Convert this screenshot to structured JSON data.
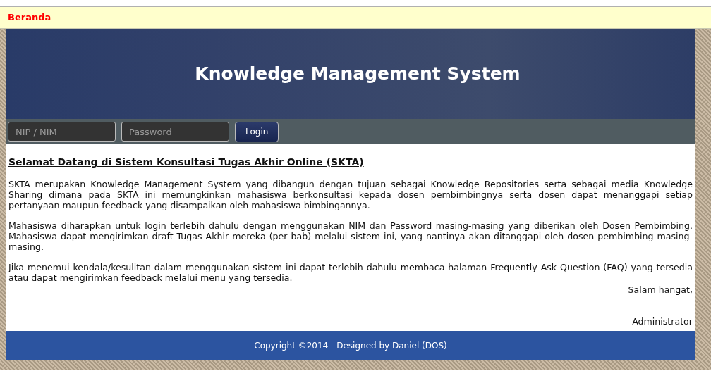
{
  "top_bar": {
    "breadcrumb": "Beranda"
  },
  "header": {
    "title": "Knowledge Management System"
  },
  "login_bar": {
    "username": {
      "placeholder": "NIP / NIM"
    },
    "password": {
      "placeholder": "Password"
    },
    "button": "Login"
  },
  "content": {
    "heading": "Selamat Datang di Sistem Konsultasi Tugas Akhir Online (SKTA)",
    "paragraphs": [
      "SKTA merupakan Knowledge Management System yang dibangun dengan tujuan sebagai Knowledge Repositories serta sebagai media Knowledge Sharing dimana pada SKTA ini memungkinkan mahasiswa berkonsultasi kepada dosen pembimbingnya serta dosen dapat menanggapi setiap pertanyaan maupun feedback yang disampaikan oleh mahasiswa bimbingannya.",
      "Mahasiswa diharapkan untuk login terlebih dahulu dengan menggunakan NIM dan Password masing-masing yang diberikan oleh Dosen Pembimbing. Mahasiswa dapat mengirimkan draft Tugas Akhir mereka (per bab) melalui sistem ini, yang nantinya akan ditanggapi oleh dosen pembimbing masing-masing.",
      "Jika menemui kendala/kesulitan dalam menggunakan sistem ini dapat terlebih dahulu membaca halaman Frequently Ask Question (FAQ) yang tersedia atau dapat mengirimkan feedback melalui menu yang tersedia."
    ],
    "closing": "Salam hangat,",
    "signature": "Administrator"
  },
  "footer": {
    "text": "Copyright ©2014 - Designed by Daniel (DOS)"
  }
}
